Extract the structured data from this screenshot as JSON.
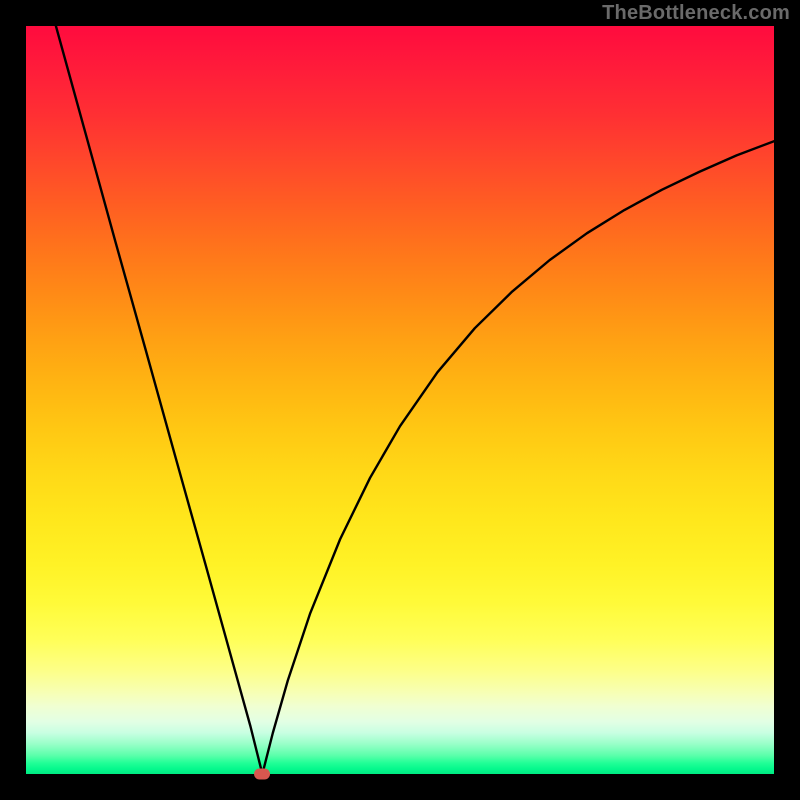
{
  "watermark": {
    "text": "TheBottleneck.com"
  },
  "colors": {
    "marker": "#d8574f",
    "curve": "#000000",
    "page_bg": "#000000"
  },
  "chart_data": {
    "type": "line",
    "title": "",
    "xlabel": "",
    "ylabel": "",
    "xlim": [
      0,
      100
    ],
    "ylim": [
      0,
      100
    ],
    "gradient_stops": [
      {
        "pct": 0,
        "color": "#ff0b3e"
      },
      {
        "pct": 50,
        "color": "#ffc813"
      },
      {
        "pct": 82,
        "color": "#ffff58"
      },
      {
        "pct": 96,
        "color": "#98ffc8"
      },
      {
        "pct": 100,
        "color": "#00ea82"
      }
    ],
    "marker": {
      "x": 31.6,
      "y": 0,
      "color": "#d8574f"
    },
    "series": [
      {
        "name": "bottleneck-curve",
        "x": [
          4.0,
          8.0,
          12.0,
          16.0,
          20.0,
          24.0,
          28.0,
          30.0,
          31.6,
          33.0,
          35.0,
          38.0,
          42.0,
          46.0,
          50.0,
          55.0,
          60.0,
          65.0,
          70.0,
          75.0,
          80.0,
          85.0,
          90.0,
          95.0,
          100.0
        ],
        "y": [
          100.0,
          85.5,
          71.0,
          56.7,
          42.3,
          28.0,
          13.6,
          6.4,
          0.0,
          5.5,
          12.5,
          21.5,
          31.4,
          39.6,
          46.5,
          53.7,
          59.6,
          64.5,
          68.7,
          72.3,
          75.4,
          78.1,
          80.5,
          82.7,
          84.6
        ]
      }
    ]
  }
}
